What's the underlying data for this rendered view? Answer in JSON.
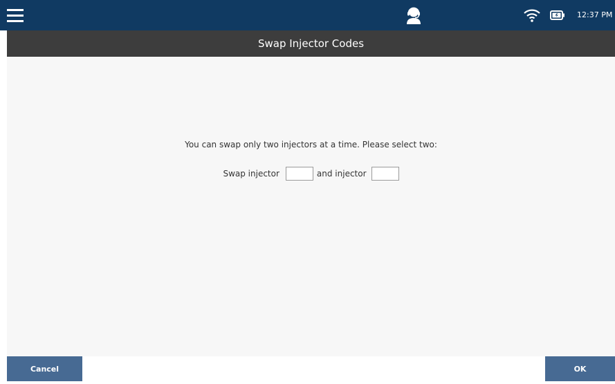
{
  "status_bar": {
    "time": "12:37 PM",
    "icons": [
      "hamburger-menu-icon",
      "support-agent-icon",
      "wifi-icon",
      "battery-icon"
    ]
  },
  "header": {
    "title": "Swap Injector Codes"
  },
  "main": {
    "instruction": "You can swap only two injectors at a time. Please select two:",
    "swap_label_1": "Swap injector",
    "swap_label_2": "and injector",
    "injector_1_value": "",
    "injector_2_value": ""
  },
  "footer": {
    "cancel_label": "Cancel",
    "ok_label": "OK"
  },
  "colors": {
    "status_bar": "#103a62",
    "title_bar": "#3d3d3d",
    "content_bg": "#f7f7f7",
    "button": "#476a93"
  }
}
